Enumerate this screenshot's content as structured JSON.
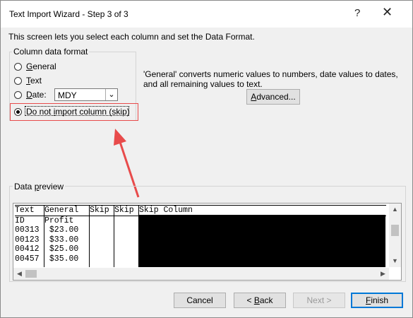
{
  "window": {
    "title": "Text Import Wizard - Step 3 of 3",
    "help_glyph": "?",
    "close_glyph": "✕"
  },
  "instruction": "This screen lets you select each column and set the Data Format.",
  "column_format": {
    "legend": "Column data format",
    "options": [
      {
        "pre": "",
        "key": "G",
        "post": "eneral",
        "checked": false
      },
      {
        "pre": "",
        "key": "T",
        "post": "ext",
        "checked": false
      },
      {
        "pre": "",
        "key": "D",
        "post": "ate:",
        "checked": false
      },
      {
        "pre": "Do not ",
        "key": "i",
        "post": "mport column (skip)",
        "checked": true
      }
    ],
    "date_value": "MDY"
  },
  "description": "'General' converts numeric values to numbers, date values to dates, and all remaining values to text.",
  "advanced_button": {
    "pre": "",
    "key": "A",
    "post": "dvanced..."
  },
  "preview": {
    "legend_pre": "Data ",
    "legend_key": "p",
    "legend_post": "review",
    "columns": [
      {
        "header": "Text",
        "cells": [
          "ID",
          "00313",
          "00123",
          "00412",
          "00457"
        ]
      },
      {
        "header": "General",
        "cells": [
          "Profit",
          " $23.00",
          " $33.00",
          " $25.00",
          " $35.00"
        ]
      },
      {
        "header": "Skip",
        "cells": [
          "",
          "",
          "",
          "",
          ""
        ]
      },
      {
        "header": "Skip",
        "cells": [
          "",
          "",
          "",
          "",
          ""
        ]
      },
      {
        "header": "Skip Column",
        "cells": [
          "",
          "",
          "",
          "",
          ""
        ]
      }
    ]
  },
  "footer": {
    "cancel": "Cancel",
    "back": {
      "pre": "< ",
      "key": "B",
      "post": "ack"
    },
    "next": "Next >",
    "finish": {
      "pre": "",
      "key": "F",
      "post": "inish"
    }
  },
  "colors": {
    "highlight_border": "#e84b4b",
    "arrow": "#e84b4b",
    "selected_column": "#000000"
  }
}
